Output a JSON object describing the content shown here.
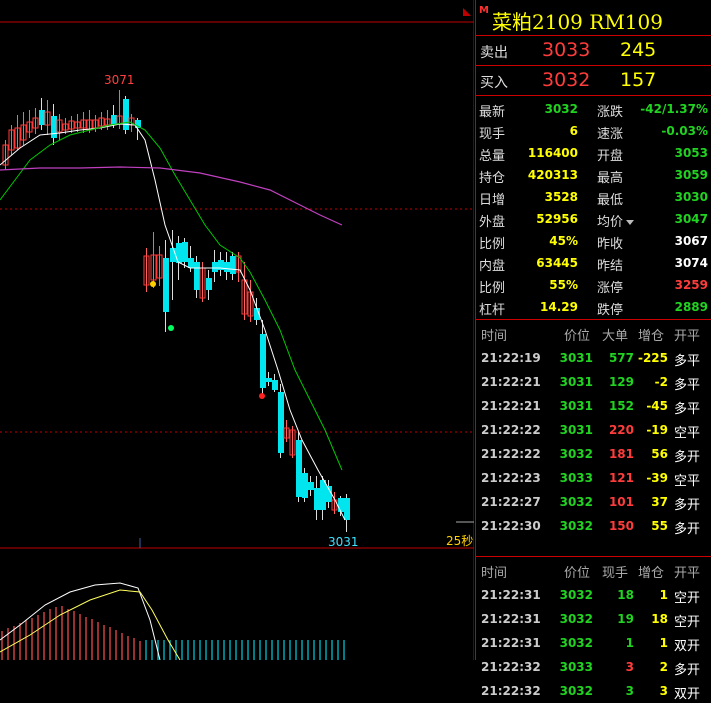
{
  "instrument": {
    "marker": "M",
    "name": "菜粕2109 RM109"
  },
  "chart": {
    "high_label": "3071",
    "last_label": "3031",
    "seconds_label": "25秒"
  },
  "orderbook": {
    "sell": {
      "label": "卖出",
      "price": "3033",
      "volume": "245"
    },
    "buy": {
      "label": "买入",
      "price": "3032",
      "volume": "157"
    }
  },
  "quote": [
    {
      "l1": "最新",
      "v1": "3032",
      "c1": "green",
      "l2": "涨跌",
      "v2": "-42/1.37%",
      "c2": "green"
    },
    {
      "l1": "现手",
      "v1": "6",
      "c1": "yellow",
      "l2": "速涨",
      "v2": "-0.03%",
      "c2": "green"
    },
    {
      "l1": "总量",
      "v1": "116400",
      "c1": "yellow",
      "l2": "开盘",
      "v2": "3053",
      "c2": "green"
    },
    {
      "l1": "持仓",
      "v1": "420313",
      "c1": "yellow",
      "l2": "最高",
      "v2": "3059",
      "c2": "green"
    },
    {
      "l1": "日增",
      "v1": "3528",
      "c1": "yellow",
      "l2": "最低",
      "v2": "3030",
      "c2": "green"
    },
    {
      "l1": "外盘",
      "v1": "52956",
      "c1": "yellow",
      "l2": "均价",
      "v2": "3047",
      "c2": "green",
      "dropdown": true
    },
    {
      "l1": "比例",
      "v1": "45%",
      "c1": "yellow",
      "l2": "昨收",
      "v2": "3067",
      "c2": "white"
    },
    {
      "l1": "内盘",
      "v1": "63445",
      "c1": "yellow",
      "l2": "昨结",
      "v2": "3074",
      "c2": "white"
    },
    {
      "l1": "比例",
      "v1": "55%",
      "c1": "yellow",
      "l2": "涨停",
      "v2": "3259",
      "c2": "red"
    },
    {
      "l1": "杠杆",
      "v1": "14.29",
      "c1": "yellow",
      "l2": "跌停",
      "v2": "2889",
      "c2": "green"
    }
  ],
  "ticks_header": {
    "time": "时间",
    "price": "价位",
    "big": "大单",
    "pos": "增仓",
    "type": "开平"
  },
  "ticks": [
    {
      "time": "21:22:19",
      "price": "3031",
      "pc": "green",
      "big": "577",
      "bc": "green",
      "pos": "-225",
      "pcol": "yellow",
      "type": "多平"
    },
    {
      "time": "21:22:21",
      "price": "3031",
      "pc": "green",
      "big": "129",
      "bc": "green",
      "pos": "-2",
      "pcol": "yellow",
      "type": "多平"
    },
    {
      "time": "21:22:21",
      "price": "3031",
      "pc": "green",
      "big": "152",
      "bc": "green",
      "pos": "-45",
      "pcol": "yellow",
      "type": "多平"
    },
    {
      "time": "21:22:22",
      "price": "3031",
      "pc": "green",
      "big": "220",
      "bc": "red",
      "pos": "-19",
      "pcol": "yellow",
      "type": "空平"
    },
    {
      "time": "21:22:22",
      "price": "3032",
      "pc": "green",
      "big": "181",
      "bc": "red",
      "pos": "56",
      "pcol": "yellow",
      "type": "多开"
    },
    {
      "time": "21:22:23",
      "price": "3033",
      "pc": "green",
      "big": "121",
      "bc": "red",
      "pos": "-39",
      "pcol": "yellow",
      "type": "空平"
    },
    {
      "time": "21:22:27",
      "price": "3032",
      "pc": "green",
      "big": "101",
      "bc": "red",
      "pos": "37",
      "pcol": "yellow",
      "type": "多开"
    },
    {
      "time": "21:22:30",
      "price": "3032",
      "pc": "green",
      "big": "150",
      "bc": "red",
      "pos": "55",
      "pcol": "yellow",
      "type": "多开"
    }
  ],
  "ticks2_header": {
    "time": "时间",
    "price": "价位",
    "vol": "现手",
    "pos": "增仓",
    "type": "开平"
  },
  "ticks2": [
    {
      "time": "21:22:31",
      "price": "3032",
      "pc": "green",
      "vol": "18",
      "vc": "green",
      "pos": "1",
      "pcol": "yellow",
      "type": "空开"
    },
    {
      "time": "21:22:31",
      "price": "3032",
      "pc": "green",
      "vol": "19",
      "vc": "green",
      "pos": "18",
      "pcol": "yellow",
      "type": "空开"
    },
    {
      "time": "21:22:31",
      "price": "3032",
      "pc": "green",
      "vol": "1",
      "vc": "green",
      "pos": "1",
      "pcol": "yellow",
      "type": "双开"
    },
    {
      "time": "21:22:32",
      "price": "3033",
      "pc": "green",
      "vol": "3",
      "vc": "red",
      "pos": "2",
      "pcol": "yellow",
      "type": "多开"
    },
    {
      "time": "21:22:32",
      "price": "3032",
      "pc": "green",
      "vol": "3",
      "vc": "green",
      "pos": "3",
      "pcol": "yellow",
      "type": "双开"
    }
  ],
  "colors": {
    "up": "#ff3c3c",
    "down": "#00e5ee",
    "ma_short": "#ffffff",
    "ma_mid": "#00c800",
    "ma_long": "#c040c0",
    "grid": "#c00000"
  }
}
